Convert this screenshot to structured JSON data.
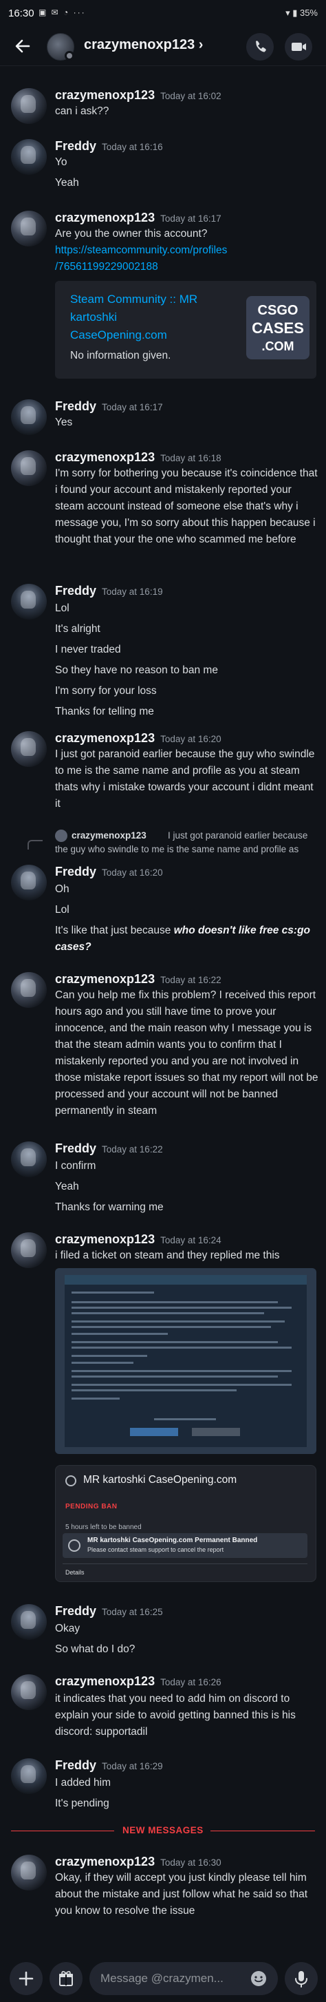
{
  "status_bar": {
    "time": "16:30",
    "left_icons": "▣ ✉ ◔ ···",
    "battery": "35%"
  },
  "header": {
    "title": "crazymenoxp123 ›"
  },
  "messages": [
    {
      "author": "crazymenoxp123",
      "time": "Today at 16:02",
      "lines": [
        "can i ask??"
      ]
    },
    {
      "author": "Freddy",
      "time": "Today at 16:16",
      "lines": [
        "Yo",
        "Yeah"
      ]
    },
    {
      "author": "crazymenoxp123",
      "time": "Today at 16:17",
      "lines": [
        "Are you the owner this account?"
      ],
      "link1": "https://steamcommunity.com/profiles",
      "link2": "/76561199229002188"
    },
    {
      "author": "Freddy",
      "time": "Today at 16:17",
      "lines": [
        "Yes"
      ]
    },
    {
      "author": "crazymenoxp123",
      "time": "Today at 16:18",
      "text": "I'm sorry for bothering you because it's coincidence that i found your account and mistakenly reported your steam account instead of someone else that's why i message you, I'm so sorry about this happen because i thought that your the one who scammed me before"
    },
    {
      "author": "Freddy",
      "time": "Today at 16:19",
      "lines": [
        "Lol",
        "It's alright",
        "I never traded",
        "So they have no reason to ban me",
        "I'm sorry for your loss",
        "Thanks for telling me"
      ]
    },
    {
      "author": "crazymenoxp123",
      "time": "Today at 16:20",
      "text": "I just got paranoid earlier because the guy who swindle to me is the same name and profile as you at steam thats why i mistake towards your account i didnt meant it"
    },
    {
      "author": "Freddy",
      "time": "Today at 16:20",
      "lines": [
        "Oh",
        "Lol"
      ],
      "line3_plain": "It's like that just because ",
      "line3_em": "who doesn't like free cs:go",
      "line4_em": "cases?"
    },
    {
      "author": "crazymenoxp123",
      "time": "Today at 16:22",
      "text": "Can you help me fix this problem? I received this report hours ago and you still have time to prove your innocence, and the main reason why I message you is that the steam admin wants you to confirm that I mistakenly reported you and you are not involved in those mistake report issues so that my report will not be processed and your account will not be banned permanently in steam"
    },
    {
      "author": "Freddy",
      "time": "Today at 16:22",
      "lines": [
        "I confirm",
        "Yeah",
        "Thanks for warning me"
      ]
    },
    {
      "author": "crazymenoxp123",
      "time": "Today at 16:24",
      "lines": [
        "i filed a ticket on steam and they replied me this"
      ]
    },
    {
      "author": "Freddy",
      "time": "Today at 16:25",
      "lines": [
        "Okay",
        "So what do I do?"
      ]
    },
    {
      "author": "crazymenoxp123",
      "time": "Today at 16:26",
      "text": "it indicates that you need to add him on discord to explain your side to avoid getting banned this is his discord:  supportadil"
    },
    {
      "author": "Freddy",
      "time": "Today at 16:29",
      "lines": [
        "I added him",
        "It's pending"
      ]
    },
    {
      "author": "crazymenoxp123",
      "time": "Today at 16:30",
      "text": "Okay, if they will accept you just kindly please tell him about the mistake and just follow what he said so that you know to resolve the issue"
    }
  ],
  "embed": {
    "title": "Steam Community :: MR kartoshki CaseOpening.com",
    "description": "No information given.",
    "thumb_lines": [
      "CSGO",
      "CASES",
      ".COM"
    ]
  },
  "reply": {
    "author": "crazymenoxp123",
    "text1": "I just got paranoid earlier because",
    "text2": "the guy who swindle to me is the same name and profile as"
  },
  "ticket": {
    "title": "MR kartoshki CaseOpening.com",
    "status": "PENDING BAN",
    "hours": "5 hours left to be banned",
    "box_title": "MR kartoshki CaseOpening.com Permanent Banned",
    "box_sub": "Please contact steam support to cancel the report",
    "details": "Details"
  },
  "divider": {
    "label": "NEW MESSAGES"
  },
  "composer": {
    "placeholder": "Message @crazymen..."
  },
  "colors": {
    "background": "#101318",
    "link": "#00a8fc",
    "new_messages": "#f23f43"
  }
}
